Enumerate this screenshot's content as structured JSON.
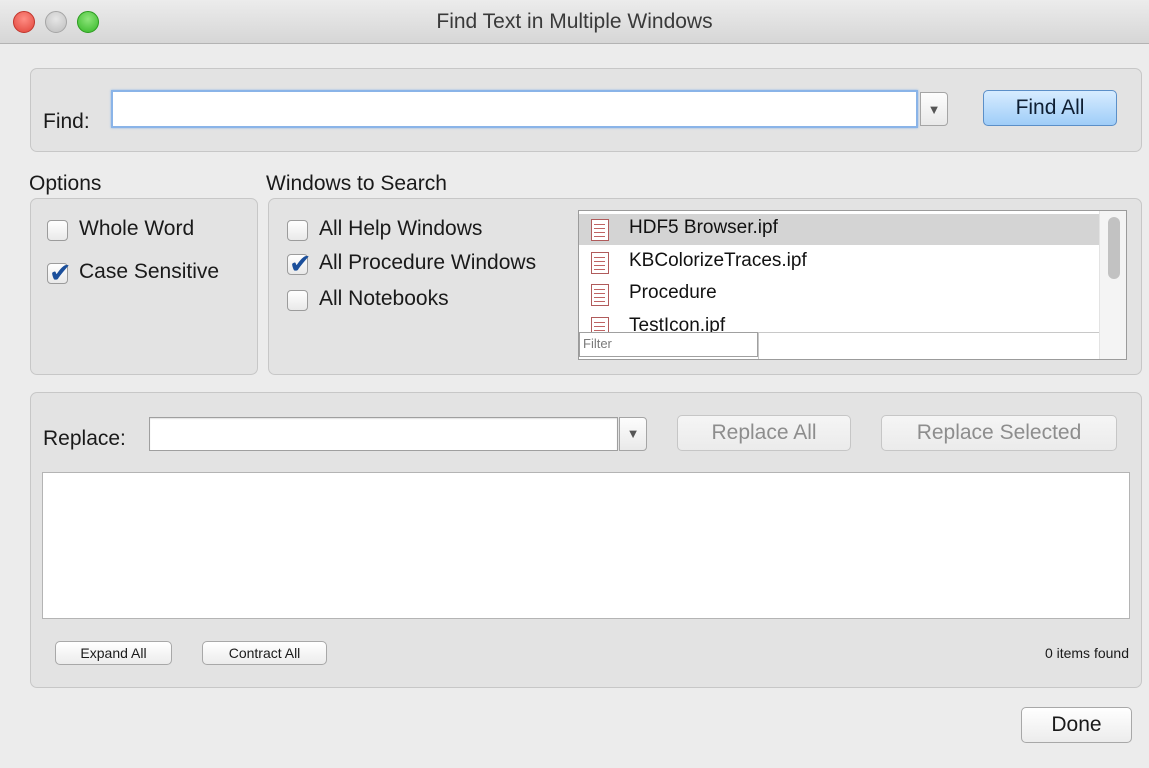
{
  "window": {
    "title": "Find Text in Multiple Windows"
  },
  "find": {
    "label": "Find:",
    "value": "",
    "arrow": "▼",
    "button": "Find All"
  },
  "options": {
    "heading": "Options",
    "whole_word": {
      "label": "Whole Word",
      "checked": false
    },
    "case_sensitive": {
      "label": "Case Sensitive",
      "checked": true
    }
  },
  "windows_to_search": {
    "heading": "Windows to Search",
    "help": {
      "label": "All Help Windows",
      "checked": false
    },
    "procedure": {
      "label": "All Procedure Windows",
      "checked": true
    },
    "notebooks": {
      "label": "All Notebooks",
      "checked": false
    },
    "list_items": [
      {
        "label": "HDF5 Browser.ipf",
        "selected": true
      },
      {
        "label": "KBColorizeTraces.ipf",
        "selected": false
      },
      {
        "label": "Procedure",
        "selected": false
      },
      {
        "label": "TestIcon.ipf",
        "selected": false
      }
    ],
    "filter_placeholder": "Filter"
  },
  "replace": {
    "label": "Replace:",
    "value": "",
    "arrow": "▼",
    "replace_all": "Replace All",
    "replace_selected": "Replace Selected"
  },
  "results": {
    "expand_all": "Expand All",
    "contract_all": "Contract All",
    "status": "0 items found"
  },
  "done_button": "Done",
  "icons": {
    "checkmark": "✔",
    "document": "procedure-file-icon"
  }
}
